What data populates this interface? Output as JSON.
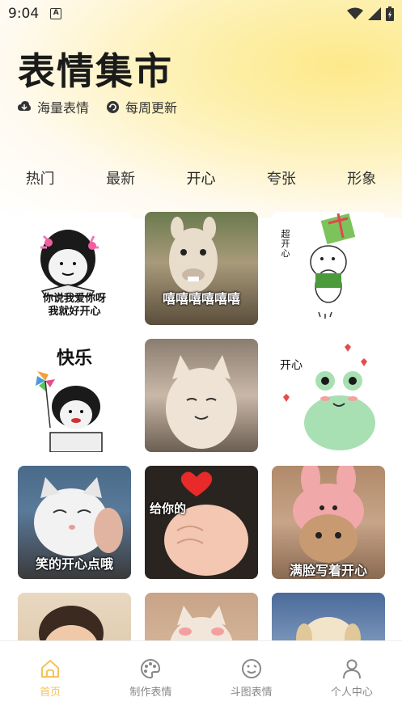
{
  "status_bar": {
    "time": "9:04",
    "notification_letter": "A"
  },
  "header": {
    "title": "表情集市",
    "features": [
      {
        "icon": "cloud-download-icon",
        "label": "海量表情"
      },
      {
        "icon": "refresh-icon",
        "label": "每周更新"
      }
    ]
  },
  "tabs": [
    {
      "label": "热门",
      "active": false
    },
    {
      "label": "最新",
      "active": false
    },
    {
      "label": "开心",
      "active": true
    },
    {
      "label": "夸张",
      "active": false
    },
    {
      "label": "形象",
      "active": false
    }
  ],
  "stickers": [
    {
      "caption": "你说我爱你呀\n我就好开心",
      "kind": "cartoon-face"
    },
    {
      "caption": "嘻嘻嘻嘻嘻嘻",
      "kind": "alpaca"
    },
    {
      "caption": "超开心",
      "kind": "bear-gift"
    },
    {
      "caption": "快乐",
      "kind": "cartoon-pinwheel"
    },
    {
      "caption": "",
      "kind": "cat-smile"
    },
    {
      "caption": "开心",
      "kind": "frog"
    },
    {
      "caption": "笑的开心点哦",
      "kind": "cat-squish"
    },
    {
      "caption": "给你的",
      "kind": "fist-heart"
    },
    {
      "caption": "满脸写着开心",
      "kind": "cat-bunny-hat"
    },
    {
      "caption": "",
      "kind": "child"
    },
    {
      "caption": "",
      "kind": "kitten-blush"
    },
    {
      "caption": "",
      "kind": "puppy"
    }
  ],
  "bottom_nav": [
    {
      "label": "首页",
      "icon": "home-icon",
      "active": true
    },
    {
      "label": "制作表情",
      "icon": "palette-icon",
      "active": false
    },
    {
      "label": "斗图表情",
      "icon": "emoji-icon",
      "active": false
    },
    {
      "label": "个人中心",
      "icon": "person-icon",
      "active": false
    }
  ],
  "colors": {
    "accent": "#f5c35a",
    "tab_underline": "#cdb9f5"
  }
}
